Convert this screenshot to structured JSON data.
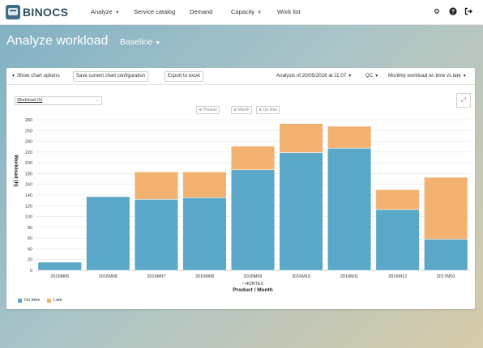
{
  "app": {
    "brand": "BINOCS"
  },
  "nav": {
    "analyze": "Analyze",
    "service_catalog": "Service catalog",
    "demand": "Demand",
    "capacity": "Capacity",
    "work_list": "Work list"
  },
  "icons": {
    "settings": "gear-icon",
    "help": "help-icon",
    "logout": "logout-icon"
  },
  "page": {
    "title": "Analyze workload",
    "scenario": "Baseline"
  },
  "toolbar": {
    "show_options": "Show chart options",
    "save_config": "Save current chart configuration",
    "export": "Export to excel",
    "analysis": "Analysis of 20/05/2016 at 11:07",
    "qc": "QC",
    "view": "Monthly workload on time vs late"
  },
  "chart_controls": {
    "measure": "Workload (h)",
    "filters": [
      "Product",
      "Month",
      "On time"
    ]
  },
  "colors": {
    "on_time": "#5aa7c8",
    "late": "#f2b272"
  },
  "chart_data": {
    "type": "bar",
    "stacked": true,
    "categories": [
      "2016M05",
      "2016M06",
      "2016M07",
      "2016M08",
      "2016M09",
      "2016M10",
      "2016M11",
      "2016M12",
      "2017M01"
    ],
    "group_label": "HONTEX",
    "xlabel": "Product / Month",
    "ylabel": "Workload (h)",
    "ylim": [
      0,
      280
    ],
    "yticks": [
      0,
      20,
      40,
      60,
      80,
      100,
      120,
      140,
      160,
      180,
      200,
      220,
      240,
      260,
      280
    ],
    "grid": true,
    "legend_position": "bottom-left",
    "series": [
      {
        "name": "On time",
        "values": [
          15,
          137,
          132,
          135,
          187,
          219,
          227,
          113,
          58
        ]
      },
      {
        "name": "Late",
        "values": [
          0,
          0,
          51,
          48,
          44,
          54,
          41,
          37,
          115
        ]
      }
    ]
  }
}
